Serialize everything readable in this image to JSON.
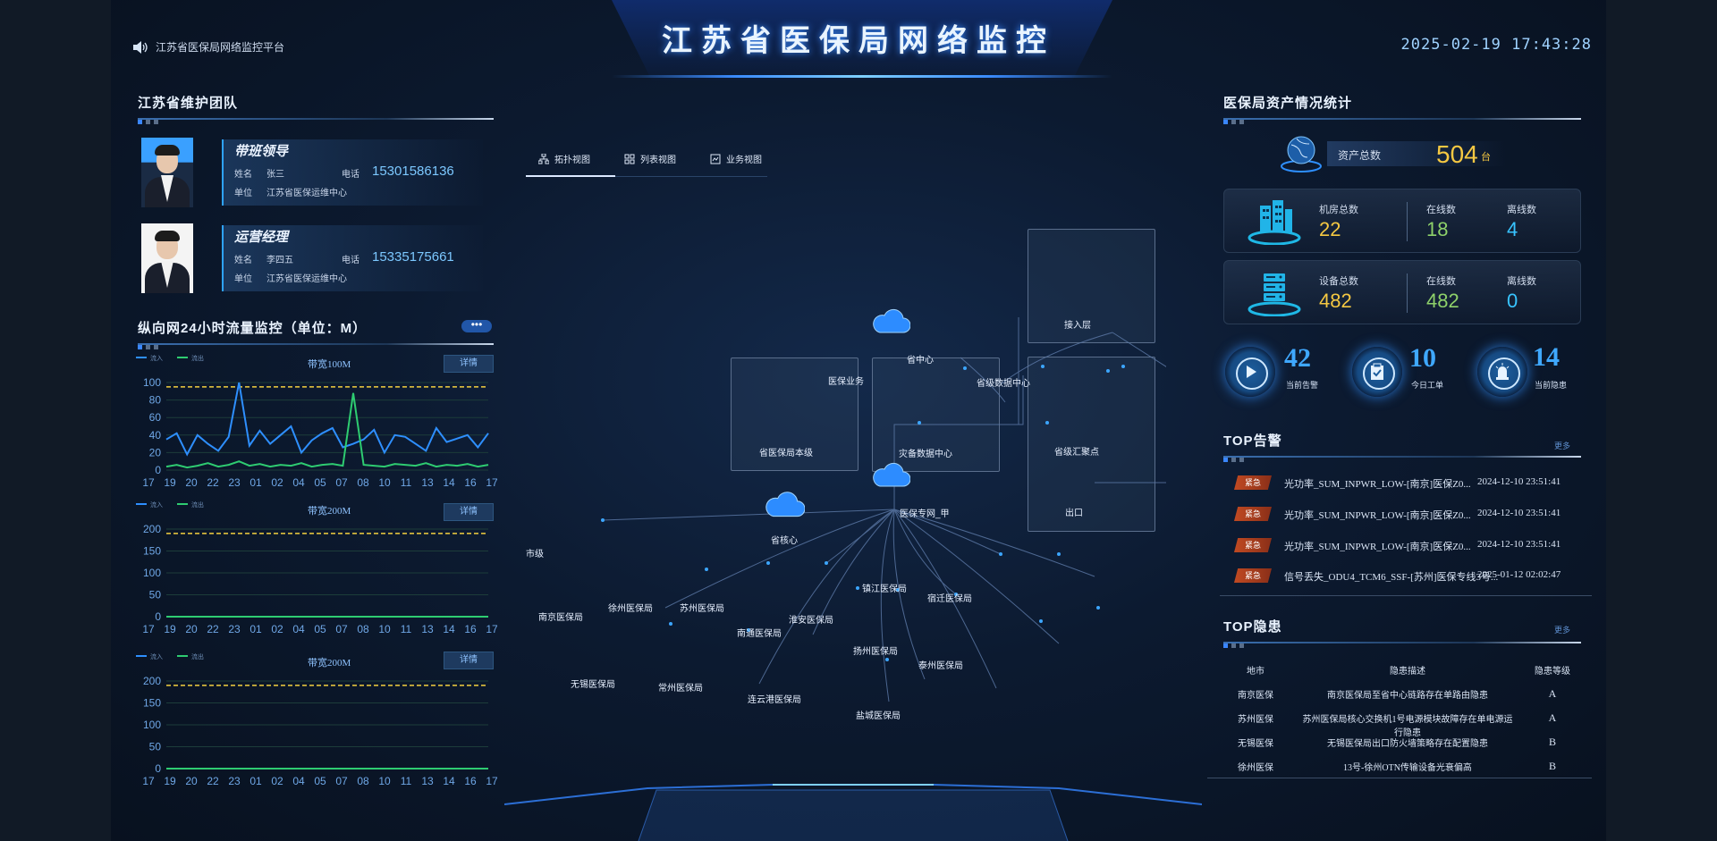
{
  "header": {
    "title": "江苏省医保局网络监控",
    "notice": "江苏省医保局网络监控平台",
    "datetime": "2025-02-19 17:43:28"
  },
  "team": {
    "title": "江苏省维护团队",
    "members": [
      {
        "role": "带班领导",
        "name_label": "姓名",
        "name": "张三",
        "phone_label": "电话",
        "phone": "15301586136",
        "unit_label": "单位",
        "unit": "江苏省医保运维中心"
      },
      {
        "role": "运营经理",
        "name_label": "姓名",
        "name": "李四五",
        "phone_label": "电话",
        "phone": "15335175661",
        "unit_label": "单位",
        "unit": "江苏省医保运维中心"
      }
    ]
  },
  "traffic": {
    "title": "纵向网24小时流量监控（单位：M）",
    "more_label": "•••",
    "legend": [
      "流入",
      "流出"
    ],
    "charts": [
      {
        "title": "带宽100M",
        "button": "详情",
        "threshold": 95,
        "ymax": 100,
        "yticks": [
          0,
          20,
          40,
          60,
          80,
          100
        ]
      },
      {
        "title": "带宽200M",
        "button": "详情",
        "threshold": 190,
        "ymax": 200,
        "yticks": [
          0,
          50,
          100,
          150,
          200
        ]
      },
      {
        "title": "带宽200M",
        "button": "详情",
        "threshold": 190,
        "ymax": 200,
        "yticks": [
          0,
          50,
          100,
          150,
          200
        ]
      }
    ],
    "xticks": [
      "17",
      "19",
      "20",
      "22",
      "23",
      "01",
      "02",
      "04",
      "05",
      "07",
      "08",
      "10",
      "11",
      "13",
      "14",
      "16",
      "17"
    ]
  },
  "chart_data": [
    {
      "type": "line",
      "title": "带宽100M",
      "xlabel": "",
      "ylabel": "",
      "ylim": [
        0,
        100
      ],
      "x": [
        "17",
        "19",
        "20",
        "22",
        "23",
        "01",
        "02",
        "04",
        "05",
        "07",
        "08",
        "10",
        "11",
        "13",
        "14",
        "16",
        "17"
      ],
      "series": [
        {
          "name": "流入",
          "values": [
            35,
            42,
            18,
            40,
            30,
            22,
            38,
            100,
            28,
            45,
            30,
            40,
            50,
            20,
            34,
            42,
            48,
            26,
            30,
            35,
            46,
            20,
            40,
            38,
            30,
            22,
            48,
            32,
            36,
            40,
            26,
            42
          ]
        },
        {
          "name": "流出",
          "values": [
            4,
            6,
            3,
            5,
            8,
            4,
            6,
            10,
            5,
            7,
            4,
            6,
            5,
            8,
            4,
            6,
            7,
            5,
            88,
            6,
            5,
            4,
            7,
            6,
            5,
            8,
            4,
            6,
            5,
            7,
            4,
            6
          ]
        }
      ]
    },
    {
      "type": "line",
      "title": "带宽200M",
      "xlabel": "",
      "ylabel": "",
      "ylim": [
        0,
        200
      ],
      "x": [
        "17",
        "19",
        "20",
        "22",
        "23",
        "01",
        "02",
        "04",
        "05",
        "07",
        "08",
        "10",
        "11",
        "13",
        "14",
        "16",
        "17"
      ],
      "series": [
        {
          "name": "流入",
          "values": [
            0,
            0,
            0,
            0,
            0,
            0,
            0,
            0,
            0,
            0,
            0,
            0,
            0,
            0,
            0,
            0,
            0
          ]
        },
        {
          "name": "流出",
          "values": [
            0,
            0,
            0,
            0,
            0,
            0,
            0,
            0,
            0,
            0,
            0,
            0,
            0,
            0,
            0,
            0,
            0
          ]
        }
      ]
    },
    {
      "type": "line",
      "title": "带宽200M",
      "xlabel": "",
      "ylabel": "",
      "ylim": [
        0,
        200
      ],
      "x": [
        "17",
        "19",
        "20",
        "22",
        "23",
        "01",
        "02",
        "04",
        "05",
        "07",
        "08",
        "10",
        "11",
        "13",
        "14",
        "16",
        "17"
      ],
      "series": [
        {
          "name": "流入",
          "values": [
            0,
            0,
            0,
            0,
            0,
            0,
            0,
            0,
            0,
            0,
            0,
            0,
            0,
            0,
            0,
            0,
            0
          ]
        },
        {
          "name": "流出",
          "values": [
            0,
            0,
            0,
            0,
            0,
            0,
            0,
            0,
            0,
            0,
            0,
            0,
            0,
            0,
            0,
            0,
            0
          ]
        }
      ]
    }
  ],
  "topology": {
    "tabs": [
      "拓扑视图",
      "列表视图",
      "业务视图"
    ],
    "labels": {
      "core_cloud": "省核心",
      "cloud2": "省中心",
      "cloud3": "医保专网_甲",
      "box1_top": "医保业务",
      "box1_bottom": "省医保局本级",
      "box2_top": "省级数据中心",
      "box2_bottom": "灾备数据中心",
      "box3_top": "接入层",
      "box3_mid": "省级汇聚点",
      "box3_bottom": "出口",
      "left_edge": "市级",
      "cities": [
        "南京医保局",
        "无锡医保局",
        "徐州医保局",
        "常州医保局",
        "苏州医保局",
        "南通医保局",
        "连云港医保局",
        "淮安医保局",
        "盐城医保局",
        "扬州医保局",
        "镇江医保局",
        "泰州医保局",
        "宿迁医保局"
      ]
    },
    "colors": {
      "accent": "#2e8fff",
      "node": "#3ca6ff"
    }
  },
  "assets": {
    "title": "医保局资产情况统计",
    "total_label": "资产总数",
    "total": "504",
    "total_unit": "台",
    "cards": [
      {
        "main_label": "机房总数",
        "main_value": "22",
        "a_label": "在线数",
        "a_value": "18",
        "b_label": "离线数",
        "b_value": "4",
        "icon": "building-icon"
      },
      {
        "main_label": "设备总数",
        "main_value": "482",
        "a_label": "在线数",
        "a_value": "482",
        "b_label": "离线数",
        "b_value": "0",
        "icon": "server-icon"
      }
    ],
    "kpis": [
      {
        "value": "42",
        "label": "当前告警",
        "icon": "play-icon"
      },
      {
        "value": "10",
        "label": "今日工单",
        "icon": "clipboard-icon"
      },
      {
        "value": "14",
        "label": "当前隐患",
        "icon": "alarm-icon"
      }
    ]
  },
  "alerts": {
    "title": "TOP告警",
    "more": "更多",
    "rows": [
      {
        "badge": "紧急",
        "text": "光功率_SUM_INPWR_LOW-[南京]医保Z0...",
        "time": "2024-12-10 23:51:41"
      },
      {
        "badge": "紧急",
        "text": "光功率_SUM_INPWR_LOW-[南京]医保Z0...",
        "time": "2024-12-10 23:51:41"
      },
      {
        "badge": "紧急",
        "text": "光功率_SUM_INPWR_LOW-[南京]医保Z0...",
        "time": "2024-12-10 23:51:41"
      },
      {
        "badge": "紧急",
        "text": "信号丢失_ODU4_TCM6_SSF-[苏州]医保专线3号...",
        "time": "2025-01-12 02:02:47"
      }
    ]
  },
  "hazards": {
    "title": "TOP隐患",
    "more": "更多",
    "headers": [
      "地市",
      "隐患描述",
      "隐患等级"
    ],
    "rows": [
      {
        "city": "南京医保",
        "desc": "南京医保局至省中心链路存在单路由隐患",
        "level": "A"
      },
      {
        "city": "苏州医保",
        "desc": "苏州医保局核心交换机1号电源模块故障存在单电源运行隐患",
        "level": "A"
      },
      {
        "city": "无锡医保",
        "desc": "无锡医保局出口防火墙策略存在配置隐患",
        "level": "B"
      },
      {
        "city": "徐州医保",
        "desc": "13号-徐州OTN传输设备光衰偏高",
        "level": "B"
      }
    ]
  }
}
